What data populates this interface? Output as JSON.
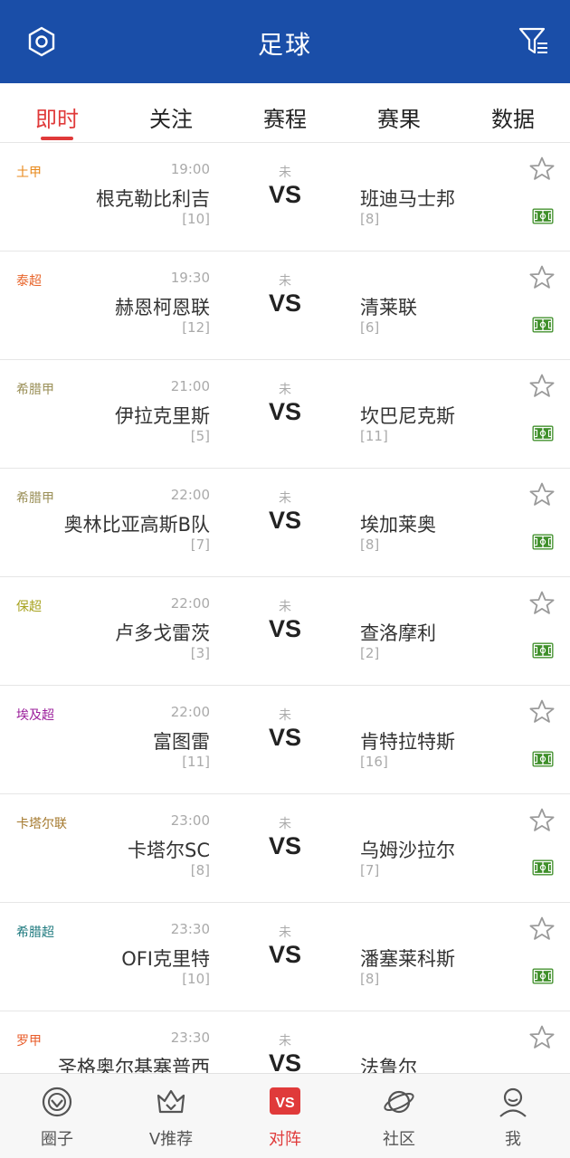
{
  "header": {
    "title": "足球",
    "settings_icon": "settings-hexagon-icon",
    "filter_icon": "filter-icon",
    "background": "#1a4ea8"
  },
  "tabs": [
    {
      "label": "即时",
      "active": true
    },
    {
      "label": "关注",
      "active": false
    },
    {
      "label": "赛程",
      "active": false
    },
    {
      "label": "赛果",
      "active": false
    },
    {
      "label": "数据",
      "active": false
    }
  ],
  "matches": [
    {
      "league": "土甲",
      "league_color": "#e8891b",
      "time": "19:00",
      "home": "根克勒比利吉",
      "home_rank": "[10]",
      "status": "未",
      "vs": "VS",
      "away": "班迪马士邦",
      "away_rank": "[8]"
    },
    {
      "league": "泰超",
      "league_color": "#e8642a",
      "time": "19:30",
      "home": "赫恩柯恩联",
      "home_rank": "[12]",
      "status": "未",
      "vs": "VS",
      "away": "清莱联",
      "away_rank": "[6]"
    },
    {
      "league": "希腊甲",
      "league_color": "#9a8f57",
      "time": "21:00",
      "home": "伊拉克里斯",
      "home_rank": "[5]",
      "status": "未",
      "vs": "VS",
      "away": "坎巴尼克斯",
      "away_rank": "[11]"
    },
    {
      "league": "希腊甲",
      "league_color": "#9a8f57",
      "time": "22:00",
      "home": "奥林比亚高斯B队",
      "home_rank": "[7]",
      "status": "未",
      "vs": "VS",
      "away": "埃加莱奥",
      "away_rank": "[8]"
    },
    {
      "league": "保超",
      "league_color": "#a7a21f",
      "time": "22:00",
      "home": "卢多戈雷茨",
      "home_rank": "[3]",
      "status": "未",
      "vs": "VS",
      "away": "查洛摩利",
      "away_rank": "[2]"
    },
    {
      "league": "埃及超",
      "league_color": "#9b1f9b",
      "time": "22:00",
      "home": "富图雷",
      "home_rank": "[11]",
      "status": "未",
      "vs": "VS",
      "away": "肯特拉特斯",
      "away_rank": "[16]"
    },
    {
      "league": "卡塔尔联",
      "league_color": "#a4782c",
      "time": "23:00",
      "home": "卡塔尔SC",
      "home_rank": "[8]",
      "status": "未",
      "vs": "VS",
      "away": "乌姆沙拉尔",
      "away_rank": "[7]"
    },
    {
      "league": "希腊超",
      "league_color": "#1f7a7f",
      "time": "23:30",
      "home": "OFI克里特",
      "home_rank": "[10]",
      "status": "未",
      "vs": "VS",
      "away": "潘塞莱科斯",
      "away_rank": "[8]"
    },
    {
      "league": "罗甲",
      "league_color": "#e85c2a",
      "time": "23:30",
      "home": "圣格奥尔基塞普西",
      "home_rank": "",
      "status": "未",
      "vs": "VS",
      "away": "法鲁尔",
      "away_rank": ""
    }
  ],
  "bottom_nav": [
    {
      "label": "圈子",
      "icon": "circle-heart-icon",
      "active": false
    },
    {
      "label": "V推荐",
      "icon": "crown-recommend-icon",
      "active": false
    },
    {
      "label": "对阵",
      "icon": "vs-badge-icon",
      "active": true
    },
    {
      "label": "社区",
      "icon": "planet-icon",
      "active": false
    },
    {
      "label": "我",
      "icon": "user-icon",
      "active": false
    }
  ],
  "colors": {
    "accent": "#e03a3a",
    "pitch_green": "#3f8f2a",
    "star_gray": "#9a9a9a"
  }
}
